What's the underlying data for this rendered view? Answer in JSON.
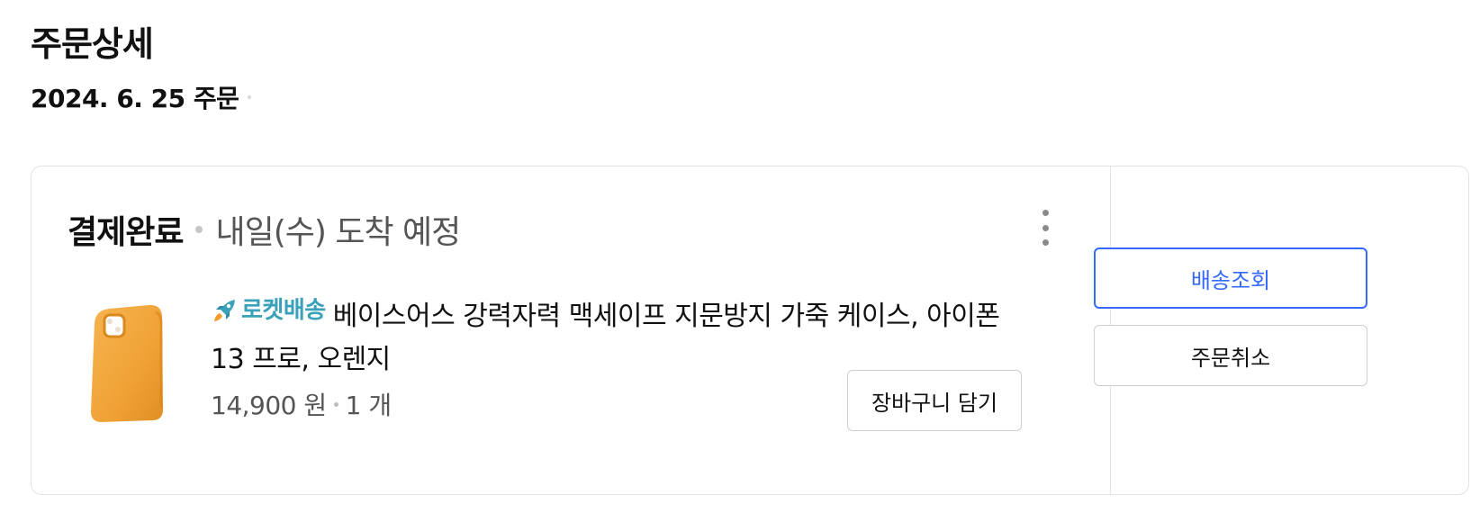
{
  "page": {
    "title": "주문상세",
    "order_date": "2024. 6. 25 주문"
  },
  "order": {
    "status": "결제완료",
    "delivery_estimate": "내일(수) 도착 예정",
    "more_icon": "more-vertical-icon",
    "product": {
      "image_icon": "phone-case-image",
      "image_color": "#f2a43a",
      "badge_icon": "rocket-icon",
      "badge_label": "로켓배송",
      "badge_color": "#3aa1b9",
      "name": "베이스어스 강력자력 맥세이프 지문방지 가죽 케이스, 아이폰 13 프로, 오렌지",
      "price": "14,900 원",
      "quantity": "1 개"
    },
    "cart_button_label": "장바구니 담기"
  },
  "actions": {
    "tracking_label": "배송조회",
    "cancel_label": "주문취소",
    "accent_color": "#346aff"
  }
}
